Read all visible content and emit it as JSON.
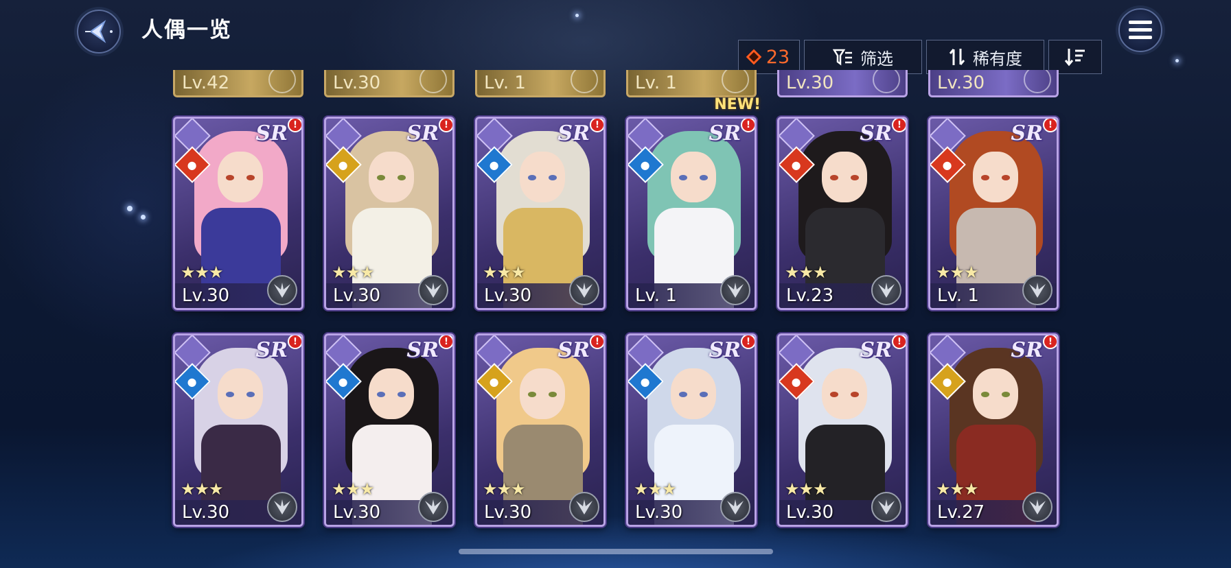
{
  "header": {
    "title": "人偶一览"
  },
  "toolbar": {
    "count": "23",
    "filter_label": "筛选",
    "sort_label": "稀有度"
  },
  "top_row": [
    {
      "level": "Lv.42",
      "style": "gold"
    },
    {
      "level": "Lv.30",
      "style": "gold"
    },
    {
      "level": "Lv. 1",
      "style": "gold"
    },
    {
      "level": "Lv. 1",
      "style": "gold"
    },
    {
      "level": "Lv.30",
      "style": "purple"
    },
    {
      "level": "Lv.30",
      "style": "purple"
    }
  ],
  "cards": [
    {
      "rarity": "SR",
      "level": "Lv.30",
      "stars": "★★★",
      "element": "fire",
      "new": "",
      "hair": "#f2a9c8",
      "body": "#3b3a9a"
    },
    {
      "rarity": "SR",
      "level": "Lv.30",
      "stars": "★★★",
      "element": "light",
      "new": "",
      "hair": "#d9c3a2",
      "body": "#f3f0e6"
    },
    {
      "rarity": "SR",
      "level": "Lv.30",
      "stars": "★★★",
      "element": "water",
      "new": "",
      "hair": "#e2ddd2",
      "body": "#d9b762"
    },
    {
      "rarity": "SR",
      "level": "Lv. 1",
      "stars": "",
      "element": "water",
      "new": "NEW!",
      "hair": "#7fc4b4",
      "body": "#f4f4f7"
    },
    {
      "rarity": "SR",
      "level": "Lv.23",
      "stars": "★★★",
      "element": "fire",
      "new": "",
      "hair": "#1e1a1c",
      "body": "#2b2a2f"
    },
    {
      "rarity": "SR",
      "level": "Lv. 1",
      "stars": "★★★",
      "element": "fire",
      "new": "",
      "hair": "#b14a22",
      "body": "#c7b9b0"
    },
    {
      "rarity": "SR",
      "level": "Lv.30",
      "stars": "★★★",
      "element": "water",
      "new": "",
      "hair": "#d8d2e6",
      "body": "#3a2a46"
    },
    {
      "rarity": "SR",
      "level": "Lv.30",
      "stars": "★★★",
      "element": "water",
      "new": "",
      "hair": "#1a1618",
      "body": "#f4eeee"
    },
    {
      "rarity": "SR",
      "level": "Lv.30",
      "stars": "★★★",
      "element": "light",
      "new": "",
      "hair": "#f0c98a",
      "body": "#9a8a70"
    },
    {
      "rarity": "SR",
      "level": "Lv.30",
      "stars": "★★★",
      "element": "water",
      "new": "",
      "hair": "#cfd8ea",
      "body": "#eef3fb"
    },
    {
      "rarity": "SR",
      "level": "Lv.30",
      "stars": "★★★",
      "element": "fire",
      "new": "",
      "hair": "#dfe3ee",
      "body": "#232226"
    },
    {
      "rarity": "SR",
      "level": "Lv.27",
      "stars": "★★★",
      "element": "light",
      "new": "",
      "hair": "#5a3522",
      "body": "#8a2b22"
    }
  ],
  "colors": {
    "fire": "#d8381e",
    "water": "#1f78d0",
    "light": "#d6a21c"
  }
}
